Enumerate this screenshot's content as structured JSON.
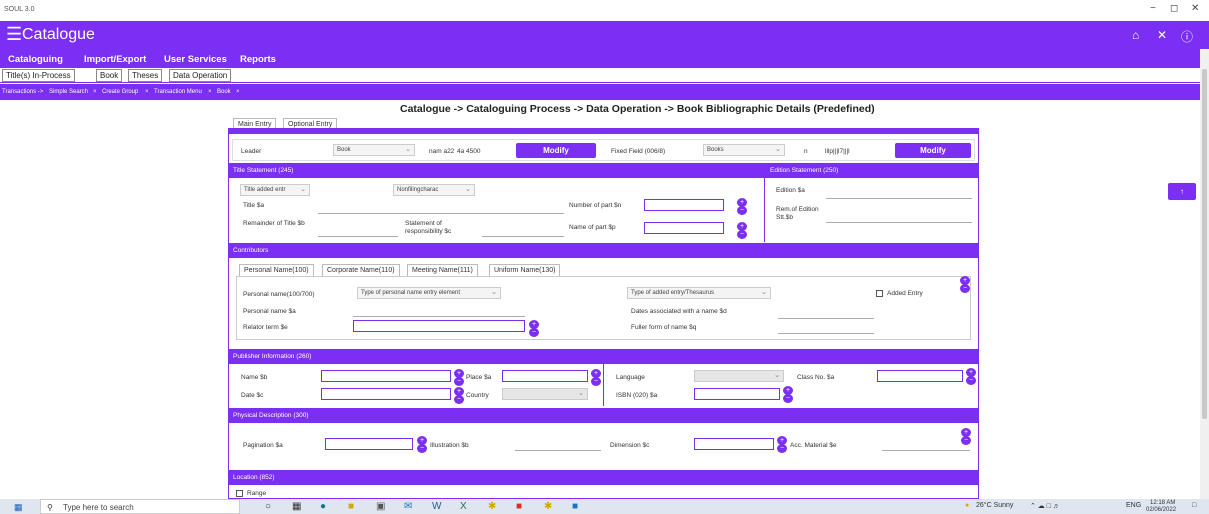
{
  "window": {
    "title": "SOUL 3.0",
    "minimize": "−",
    "restore": "◻",
    "close": "✕"
  },
  "appbar": {
    "menu_icon": "hamburger-icon",
    "title": "Catalogue",
    "home_icon": "home-icon",
    "close_icon": "close-icon",
    "help_icon": "help-icon"
  },
  "menu": [
    "Cataloguing",
    "Import/Export",
    "User Services",
    "Reports"
  ],
  "submenu": [
    "Title(s) In-Process",
    "Book",
    "Theses",
    "Data Operation"
  ],
  "breadcrumbs": [
    "Transactions ->",
    "Simple Search",
    "×",
    "Create Group",
    "×",
    "Transaction Menu",
    "×",
    "Book",
    "×"
  ],
  "page_heading": "Catalogue -> Cataloguing Process -> Data Operation -> Book Bibliographic Details (Predefined)",
  "entry_tabs": [
    "Main Entry",
    "Optional Entry"
  ],
  "leader": {
    "label": "Leader",
    "type_value": "Book",
    "code1": "nam a22",
    "code2": "4a 4500",
    "modify_label": "Modify",
    "fixed_label": "Fixed Field (006/8)",
    "fixed_value": "Books",
    "fixed_code1": "n",
    "fixed_code2": "lllp|||l7|||l",
    "modify2_label": "Modify"
  },
  "title_statement": {
    "header": "Title Statement (245)",
    "title_added_select": "Title added entr",
    "nonfiling_select": "Nonfilingcharac",
    "title_a": "Title $a",
    "number_of_part": "Number of part $n",
    "remainder_title": "Remainder of Title $b",
    "statement_resp": "Statement of responsibility $c",
    "name_of_part": "Name of part $p"
  },
  "edition": {
    "header": "Edition Statement (250)",
    "edition_a": "Edition $a",
    "rem_edition": "Rem.of Edition Stt.$b"
  },
  "contributors": {
    "header": "Contributors",
    "tabs": [
      "Personal Name(100)",
      "Corporate Name(110)",
      "Meeting Name(111)",
      "Uniform Name(130)"
    ],
    "personal_name_label": "Personal name(100/700)",
    "type_entry_select": "Type of personal name entry element",
    "type_added_select": "Type of added entry/Thesaurus",
    "added_entry": "Added Entry",
    "personal_name_a": "Personal name $a",
    "dates_d": "Dates associated with a name $d",
    "relator_e": "Relator term $e",
    "fuller_q": "Fuller form of name $q"
  },
  "publisher": {
    "header": "Publisher Information (260)",
    "name_b": "Name $b",
    "place_a": "Place $a",
    "language": "Language",
    "class_no": "Class No. $a",
    "date_c": "Date $c",
    "country": "Country",
    "isbn": "ISBN (020) $a"
  },
  "physical": {
    "header": "Physical Description (300)",
    "pagination": "Pagination $a",
    "illustration": "Illustration $b",
    "dimension": "Dimension $c",
    "acc_material": "Acc. Material $e"
  },
  "location": {
    "header": "Location (852)",
    "range": "Range"
  },
  "scroll_up": "↑",
  "taskbar": {
    "search_placeholder": "Type here to search",
    "search_icon": "search-icon",
    "weather": "26°C  Sunny",
    "lang": "ENG",
    "time": "12:18 AM",
    "date": "02/06/2022"
  },
  "colors": {
    "accent": "#7b2ff2"
  }
}
